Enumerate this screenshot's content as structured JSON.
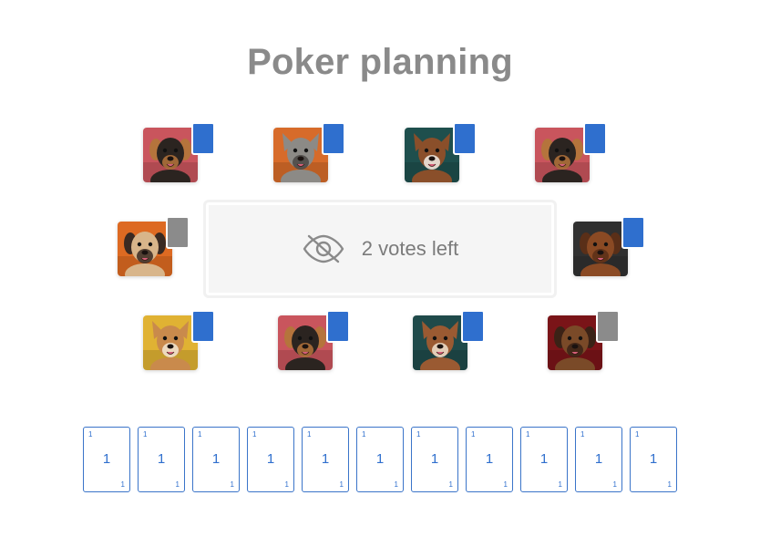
{
  "title": "Poker planning",
  "table": {
    "status_text": "2 votes left",
    "icon": "eye-off-icon"
  },
  "players": [
    {
      "id": "p1",
      "avatar": "rottweiler",
      "bg": "#c9555d",
      "fur": "#2b2420",
      "accent": "#b5743c",
      "vote_status": "voted"
    },
    {
      "id": "p2",
      "avatar": "terrier",
      "bg": "#d76b2a",
      "fur": "#8c8a86",
      "accent": "#4a4744",
      "vote_status": "voted"
    },
    {
      "id": "p3",
      "avatar": "boxer",
      "bg": "#1e4f4d",
      "fur": "#8a4f2a",
      "accent": "#f2ede6",
      "vote_status": "voted"
    },
    {
      "id": "p4",
      "avatar": "rottweiler",
      "bg": "#c9555d",
      "fur": "#2b2420",
      "accent": "#b5743c",
      "vote_status": "voted"
    },
    {
      "id": "p5",
      "avatar": "pug",
      "bg": "#dd6a22",
      "fur": "#d8b58a",
      "accent": "#3a2a22",
      "vote_status": "pending"
    },
    {
      "id": "p6",
      "avatar": "hound",
      "bg": "#303030",
      "fur": "#8a4a24",
      "accent": "#5a2f18",
      "vote_status": "voted"
    },
    {
      "id": "p7",
      "avatar": "mixed-breed",
      "bg": "#e0b233",
      "fur": "#c98a4c",
      "accent": "#f3e6d2",
      "vote_status": "voted"
    },
    {
      "id": "p8",
      "avatar": "rottweiler",
      "bg": "#c9555d",
      "fur": "#2b2420",
      "accent": "#b5743c",
      "vote_status": "voted"
    },
    {
      "id": "p9",
      "avatar": "pit-mix",
      "bg": "#1f4a4a",
      "fur": "#9a5a32",
      "accent": "#f0e2cf",
      "vote_status": "voted"
    },
    {
      "id": "p10",
      "avatar": "hound",
      "bg": "#7a1418",
      "fur": "#7a4a28",
      "accent": "#3a2216",
      "vote_status": "pending"
    }
  ],
  "deck": [
    {
      "value": "1"
    },
    {
      "value": "1"
    },
    {
      "value": "1"
    },
    {
      "value": "1"
    },
    {
      "value": "1"
    },
    {
      "value": "1"
    },
    {
      "value": "1"
    },
    {
      "value": "1"
    },
    {
      "value": "1"
    },
    {
      "value": "1"
    },
    {
      "value": "1"
    }
  ],
  "colors": {
    "voted": "#2f6fce",
    "pending": "#8b8b8b",
    "card_border": "#3a74c9",
    "title": "#8a8a8a"
  }
}
